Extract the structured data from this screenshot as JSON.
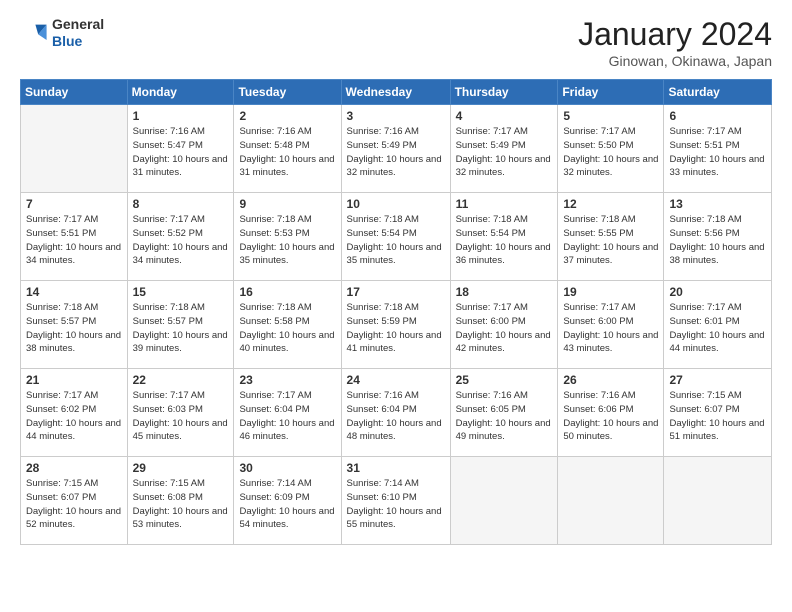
{
  "header": {
    "logo_general": "General",
    "logo_blue": "Blue",
    "month_title": "January 2024",
    "location": "Ginowan, Okinawa, Japan"
  },
  "days_of_week": [
    "Sunday",
    "Monday",
    "Tuesday",
    "Wednesday",
    "Thursday",
    "Friday",
    "Saturday"
  ],
  "weeks": [
    [
      {
        "day": "",
        "empty": true
      },
      {
        "day": "1",
        "sunrise": "7:16 AM",
        "sunset": "5:47 PM",
        "daylight": "10 hours and 31 minutes."
      },
      {
        "day": "2",
        "sunrise": "7:16 AM",
        "sunset": "5:48 PM",
        "daylight": "10 hours and 31 minutes."
      },
      {
        "day": "3",
        "sunrise": "7:16 AM",
        "sunset": "5:49 PM",
        "daylight": "10 hours and 32 minutes."
      },
      {
        "day": "4",
        "sunrise": "7:17 AM",
        "sunset": "5:49 PM",
        "daylight": "10 hours and 32 minutes."
      },
      {
        "day": "5",
        "sunrise": "7:17 AM",
        "sunset": "5:50 PM",
        "daylight": "10 hours and 32 minutes."
      },
      {
        "day": "6",
        "sunrise": "7:17 AM",
        "sunset": "5:51 PM",
        "daylight": "10 hours and 33 minutes."
      }
    ],
    [
      {
        "day": "7",
        "sunrise": "7:17 AM",
        "sunset": "5:51 PM",
        "daylight": "10 hours and 34 minutes."
      },
      {
        "day": "8",
        "sunrise": "7:17 AM",
        "sunset": "5:52 PM",
        "daylight": "10 hours and 34 minutes."
      },
      {
        "day": "9",
        "sunrise": "7:18 AM",
        "sunset": "5:53 PM",
        "daylight": "10 hours and 35 minutes."
      },
      {
        "day": "10",
        "sunrise": "7:18 AM",
        "sunset": "5:54 PM",
        "daylight": "10 hours and 35 minutes."
      },
      {
        "day": "11",
        "sunrise": "7:18 AM",
        "sunset": "5:54 PM",
        "daylight": "10 hours and 36 minutes."
      },
      {
        "day": "12",
        "sunrise": "7:18 AM",
        "sunset": "5:55 PM",
        "daylight": "10 hours and 37 minutes."
      },
      {
        "day": "13",
        "sunrise": "7:18 AM",
        "sunset": "5:56 PM",
        "daylight": "10 hours and 38 minutes."
      }
    ],
    [
      {
        "day": "14",
        "sunrise": "7:18 AM",
        "sunset": "5:57 PM",
        "daylight": "10 hours and 38 minutes."
      },
      {
        "day": "15",
        "sunrise": "7:18 AM",
        "sunset": "5:57 PM",
        "daylight": "10 hours and 39 minutes."
      },
      {
        "day": "16",
        "sunrise": "7:18 AM",
        "sunset": "5:58 PM",
        "daylight": "10 hours and 40 minutes."
      },
      {
        "day": "17",
        "sunrise": "7:18 AM",
        "sunset": "5:59 PM",
        "daylight": "10 hours and 41 minutes."
      },
      {
        "day": "18",
        "sunrise": "7:17 AM",
        "sunset": "6:00 PM",
        "daylight": "10 hours and 42 minutes."
      },
      {
        "day": "19",
        "sunrise": "7:17 AM",
        "sunset": "6:00 PM",
        "daylight": "10 hours and 43 minutes."
      },
      {
        "day": "20",
        "sunrise": "7:17 AM",
        "sunset": "6:01 PM",
        "daylight": "10 hours and 44 minutes."
      }
    ],
    [
      {
        "day": "21",
        "sunrise": "7:17 AM",
        "sunset": "6:02 PM",
        "daylight": "10 hours and 44 minutes."
      },
      {
        "day": "22",
        "sunrise": "7:17 AM",
        "sunset": "6:03 PM",
        "daylight": "10 hours and 45 minutes."
      },
      {
        "day": "23",
        "sunrise": "7:17 AM",
        "sunset": "6:04 PM",
        "daylight": "10 hours and 46 minutes."
      },
      {
        "day": "24",
        "sunrise": "7:16 AM",
        "sunset": "6:04 PM",
        "daylight": "10 hours and 48 minutes."
      },
      {
        "day": "25",
        "sunrise": "7:16 AM",
        "sunset": "6:05 PM",
        "daylight": "10 hours and 49 minutes."
      },
      {
        "day": "26",
        "sunrise": "7:16 AM",
        "sunset": "6:06 PM",
        "daylight": "10 hours and 50 minutes."
      },
      {
        "day": "27",
        "sunrise": "7:15 AM",
        "sunset": "6:07 PM",
        "daylight": "10 hours and 51 minutes."
      }
    ],
    [
      {
        "day": "28",
        "sunrise": "7:15 AM",
        "sunset": "6:07 PM",
        "daylight": "10 hours and 52 minutes."
      },
      {
        "day": "29",
        "sunrise": "7:15 AM",
        "sunset": "6:08 PM",
        "daylight": "10 hours and 53 minutes."
      },
      {
        "day": "30",
        "sunrise": "7:14 AM",
        "sunset": "6:09 PM",
        "daylight": "10 hours and 54 minutes."
      },
      {
        "day": "31",
        "sunrise": "7:14 AM",
        "sunset": "6:10 PM",
        "daylight": "10 hours and 55 minutes."
      },
      {
        "day": "",
        "empty": true
      },
      {
        "day": "",
        "empty": true
      },
      {
        "day": "",
        "empty": true
      }
    ]
  ]
}
